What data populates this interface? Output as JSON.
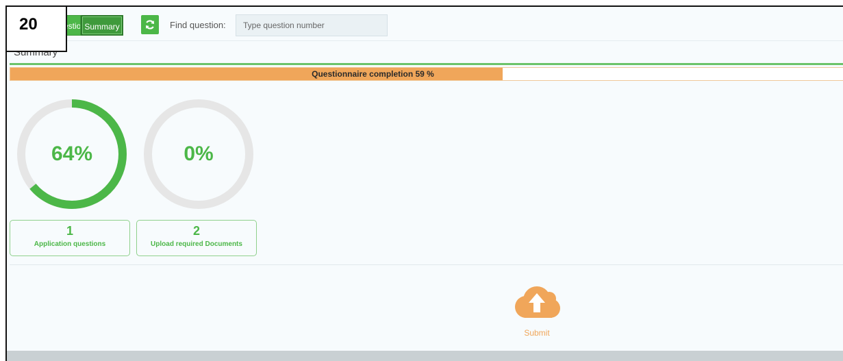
{
  "toolbar": {
    "questionnaire_label": "Questionnaire",
    "summary_label": "Summary",
    "refresh_icon": "refresh-icon",
    "find_label": "Find question:",
    "find_placeholder": "Type question number"
  },
  "section": {
    "title": "Summary"
  },
  "progress": {
    "label": "Questionnaire completion 59 %",
    "percent": 59
  },
  "gauges": [
    {
      "value_text": "64%",
      "percent": 64
    },
    {
      "value_text": "0%",
      "percent": 0
    }
  ],
  "cards": [
    {
      "number": "1",
      "label": "Application questions"
    },
    {
      "number": "2",
      "label": "Upload required Documents"
    }
  ],
  "submit": {
    "label": "Submit",
    "icon": "cloud-upload-icon"
  },
  "step_badge": "20",
  "colors": {
    "green": "#4cb748",
    "orange": "#f0a65a",
    "gauge_track": "#e6e6e6"
  }
}
